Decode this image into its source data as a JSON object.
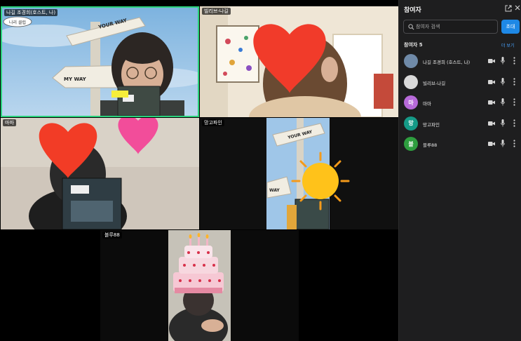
{
  "tiles": [
    {
      "name": "나길 조경희(호스트, 나)",
      "overlay_text": "나리 클럽"
    },
    {
      "name": "빌리브-나길"
    },
    {
      "name": "마마"
    },
    {
      "name": "망고파인"
    },
    {
      "name": "블루88"
    }
  ],
  "video_text": {
    "your_way": "YOUR WAY",
    "my_way": "MY WAY",
    "way": "WAY"
  },
  "panel": {
    "title": "참여자",
    "search_placeholder": "참여자 검색",
    "invite_label": "초대",
    "participants_header": "참여자 5",
    "see_more": "더 보기"
  },
  "participants": [
    {
      "name": "나길 조경희 (호스트, 나)",
      "avatar": "",
      "avatar_color": "#6f8aa8"
    },
    {
      "name": "빌리브-나길",
      "avatar": "",
      "avatar_color": "#d9d9d9"
    },
    {
      "name": "마마",
      "avatar": "마",
      "avatar_color": "#b76ad9"
    },
    {
      "name": "망고파인",
      "avatar": "망",
      "avatar_color": "#159a87"
    },
    {
      "name": "블루88",
      "avatar": "블",
      "avatar_color": "#2e9e3f"
    }
  ],
  "colors": {
    "accent": "#1e88e5",
    "active_speaker": "#2bd47d",
    "link": "#4aa3ff"
  }
}
